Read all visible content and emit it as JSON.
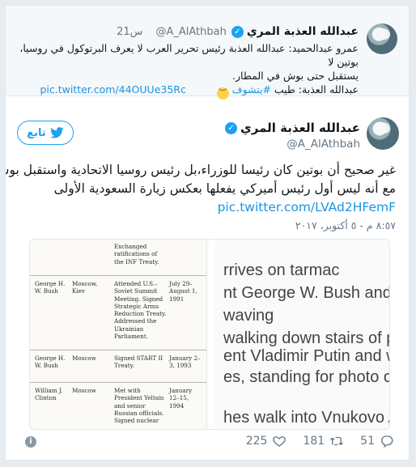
{
  "parent_tweet": {
    "display_name": "عبدالله العذبة المري",
    "handle": "@A_AlAthbah",
    "time": "21س",
    "lines": [
      "عمرو عبدالحميد: عبدالله العذبة رئيس تحرير العرب لا يعرف البرتوكول في روسيا، بوتين لا",
      "يستقبل حتى بوش في المطار."
    ],
    "reply_prefix": "عبدالله العذبة: طيب ",
    "hashtag": "#يتشوف",
    "emoji": "😌",
    "link": "pic.twitter.com/44OUUe35Rc"
  },
  "main_tweet": {
    "display_name": "عبدالله العذبة المري",
    "handle": "@A_AlAthbah",
    "follow_label": "تابع",
    "text_lines": [
      "غير صحيح أن بوتين كان رئيسا للوزراء،بل رئيس روسيا الاتحادية واستقبل بوش بالمطار",
      "مع أنه ليس أول رئيس أميركي يفعلها بعكس زيارة السعودية الأولى"
    ],
    "link": "pic.twitter.com/LVAd2HFemF",
    "date": "٨:٥٧ م - ٥ أكتوبر، ٢٠١٧"
  },
  "media": {
    "document_rows": [
      {
        "c1": "",
        "c2": "",
        "c3": "Exchanged ratifications of the INF Treaty.",
        "c4": ""
      },
      {
        "c1": "George H. W. Bush",
        "c2": "Moscow, Kiev",
        "c3": "Attended U.S.–Soviet Summit Meeting. Signed Strategic Arms Reduction Treaty. Addressed the Ukrainian Parliament.",
        "c4": "July 29– August 1, 1991"
      },
      {
        "c1": "George H. W. Bush",
        "c2": "Moscow",
        "c3": "Signed START II Treaty.",
        "c4": "January 2–3, 1993"
      },
      {
        "c1": "William J. Clinton",
        "c2": "Moscow",
        "c3": "Met with President Yeltsin and senior Russian officials. Signed nuclear",
        "c4": "January 12–15, 1994"
      }
    ],
    "video_lines": [
      "rrives on tarmac",
      "nt George W. Bush and his",
      "waving",
      "walking down stairs of plar",
      "ent Vladimir Putin and wife",
      "es, standing for photo opp",
      "hes walk into Vnukovo Airp"
    ]
  },
  "actions": {
    "replies": "51",
    "retweets": "181",
    "likes": "225"
  }
}
